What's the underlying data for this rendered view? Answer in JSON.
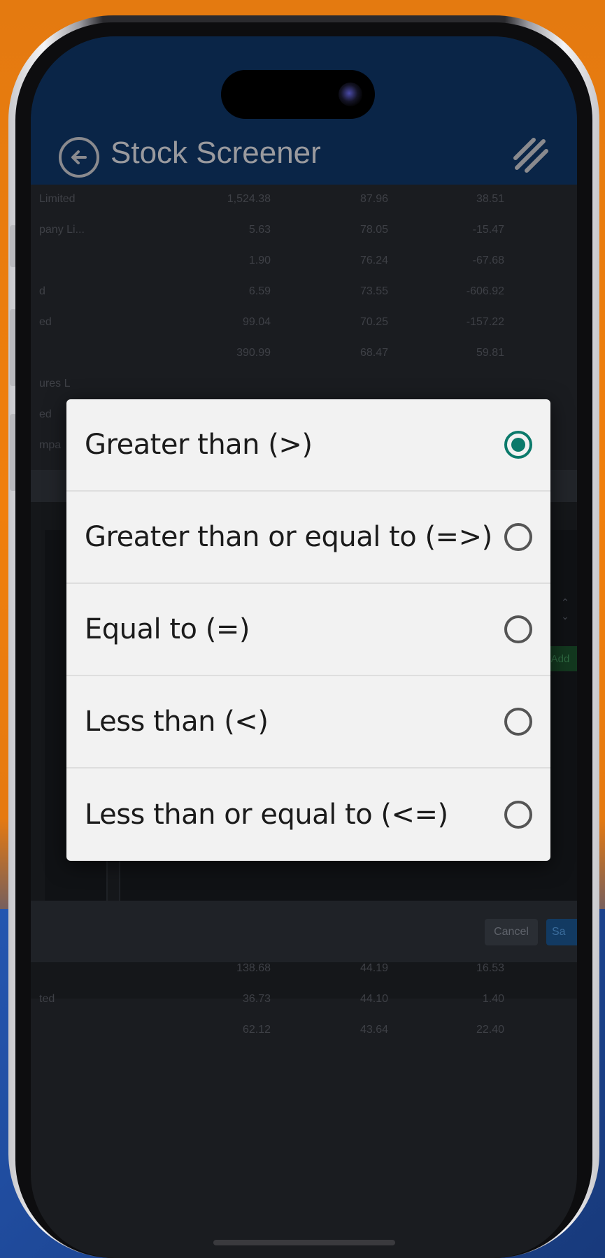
{
  "app": {
    "title": "Stock Screener"
  },
  "table_rows_top": [
    {
      "name": "Limited",
      "c1": "1,524.38",
      "c2": "87.96",
      "c3": "38.51"
    },
    {
      "name": "pany Li...",
      "c1": "5.63",
      "c2": "78.05",
      "c3": "-15.47"
    },
    {
      "name": "",
      "c1": "1.90",
      "c2": "76.24",
      "c3": "-67.68"
    },
    {
      "name": "d",
      "c1": "6.59",
      "c2": "73.55",
      "c3": "-606.92"
    },
    {
      "name": "ed",
      "c1": "99.04",
      "c2": "70.25",
      "c3": "-157.22"
    },
    {
      "name": "",
      "c1": "390.99",
      "c2": "68.47",
      "c3": "59.81"
    },
    {
      "name": "ures L",
      "c1": "",
      "c2": "",
      "c3": ""
    },
    {
      "name": "ed",
      "c1": "",
      "c2": "",
      "c3": ""
    },
    {
      "name": "mpa",
      "c1": "",
      "c2": "",
      "c3": ""
    }
  ],
  "table_rows_bottom": [
    {
      "name": "",
      "c1": "138.68",
      "c2": "44.19",
      "c3": "16.53"
    },
    {
      "name": "ted",
      "c1": "36.73",
      "c2": "44.10",
      "c3": "1.40"
    },
    {
      "name": "",
      "c1": "62.12",
      "c2": "43.64",
      "c3": "22.40"
    }
  ],
  "panel": {
    "add_label": "Add",
    "cancel_label": "Cancel",
    "save_label": "Sa"
  },
  "dialog": {
    "selected_index": 0,
    "options": [
      {
        "label": "Greater than (>)"
      },
      {
        "label": "Greater than or equal to (=>)"
      },
      {
        "label": "Equal to (=)"
      },
      {
        "label": "Less than (<)"
      },
      {
        "label": "Less than or equal to (<=)"
      }
    ]
  },
  "colors": {
    "header_bg": "#0a2547",
    "accent_radio": "#0b7a6b",
    "background_orange": "#f07f0c"
  }
}
